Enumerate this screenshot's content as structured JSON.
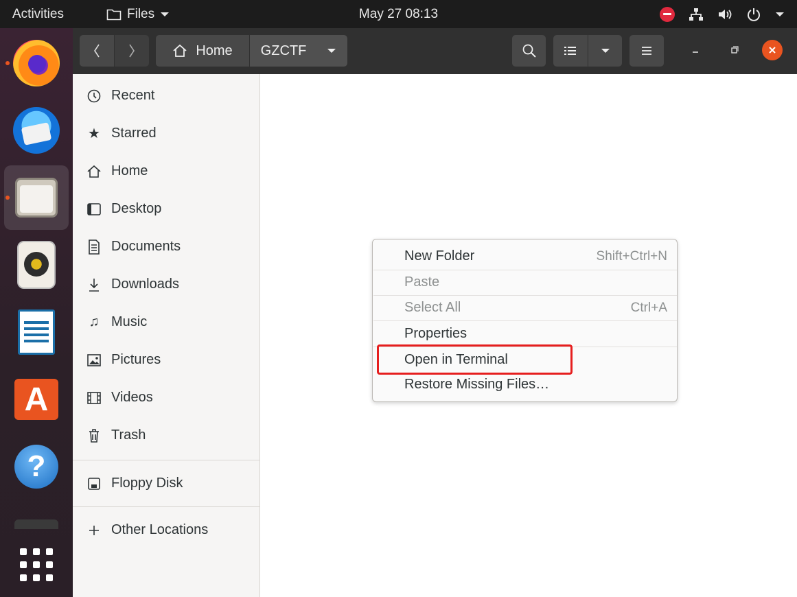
{
  "topbar": {
    "activities": "Activities",
    "app_menu": {
      "label": "Files",
      "icon": "folder-icon",
      "arrow": "chevron-down-icon"
    },
    "clock": "May 27  08:13",
    "tray_icons": [
      "do-not-disturb-icon",
      "network-icon",
      "volume-icon",
      "power-icon",
      "chevron-down-icon"
    ],
    "dnd_color": "#e0293e"
  },
  "dock": {
    "items": [
      {
        "name": "firefox",
        "icon": "firefox-icon",
        "running": true
      },
      {
        "name": "thunderbird",
        "icon": "thunderbird-icon",
        "running": false
      },
      {
        "name": "files",
        "icon": "files-icon",
        "running": true,
        "active": true
      },
      {
        "name": "rhythmbox",
        "icon": "rhythmbox-icon",
        "running": false
      },
      {
        "name": "libreoffice-writer",
        "icon": "writer-icon",
        "running": false
      },
      {
        "name": "ubuntu-software",
        "icon": "software-icon",
        "glyph": "A",
        "running": false
      },
      {
        "name": "help",
        "icon": "help-icon",
        "glyph": "?",
        "running": false
      },
      {
        "name": "terminal",
        "icon": "terminal-icon",
        "running": false
      },
      {
        "name": "show-applications",
        "icon": "app-grid-icon",
        "running": false
      }
    ],
    "running_dot_color": "#e95420"
  },
  "headerbar": {
    "back_icon": "chevron-left-icon",
    "forward_icon": "chevron-right-icon",
    "path": [
      {
        "label": "Home",
        "icon": "home-icon"
      },
      {
        "label": "GZCTF",
        "icon": "chevron-down-icon"
      }
    ],
    "search_icon": "search-icon",
    "view_icon": "list-view-icon",
    "view_dropdown_icon": "chevron-down-icon",
    "menu_icon": "hamburger-menu-icon",
    "window_controls": [
      "minimize-icon",
      "maximize-icon",
      "close-icon"
    ],
    "close_color": "#e95420"
  },
  "sidebar": {
    "places": [
      {
        "label": "Recent",
        "icon": "clock-icon"
      },
      {
        "label": "Starred",
        "icon": "star-icon"
      },
      {
        "label": "Home",
        "icon": "home-icon"
      },
      {
        "label": "Desktop",
        "icon": "desktop-icon"
      },
      {
        "label": "Documents",
        "icon": "document-icon"
      },
      {
        "label": "Downloads",
        "icon": "download-icon"
      },
      {
        "label": "Music",
        "icon": "music-icon"
      },
      {
        "label": "Pictures",
        "icon": "pictures-icon"
      },
      {
        "label": "Videos",
        "icon": "videos-icon"
      },
      {
        "label": "Trash",
        "icon": "trash-icon"
      }
    ],
    "devices": [
      {
        "label": "Floppy Disk",
        "icon": "floppy-icon"
      }
    ],
    "other": [
      {
        "label": "Other Locations",
        "icon": "plus-icon"
      }
    ]
  },
  "context_menu": {
    "items": [
      {
        "label": "New Folder",
        "accel": "Shift+Ctrl+N",
        "enabled": true
      },
      {
        "label": "Paste",
        "accel": "",
        "enabled": false
      },
      {
        "label": "Select All",
        "accel": "Ctrl+A",
        "enabled": false
      },
      {
        "label": "Properties",
        "accel": "",
        "enabled": true
      },
      {
        "label": "Open in Terminal",
        "accel": "",
        "enabled": true,
        "highlighted": true
      },
      {
        "label": "Restore Missing Files…",
        "accel": "",
        "enabled": true
      }
    ],
    "highlight_color": "#e61e1e"
  }
}
